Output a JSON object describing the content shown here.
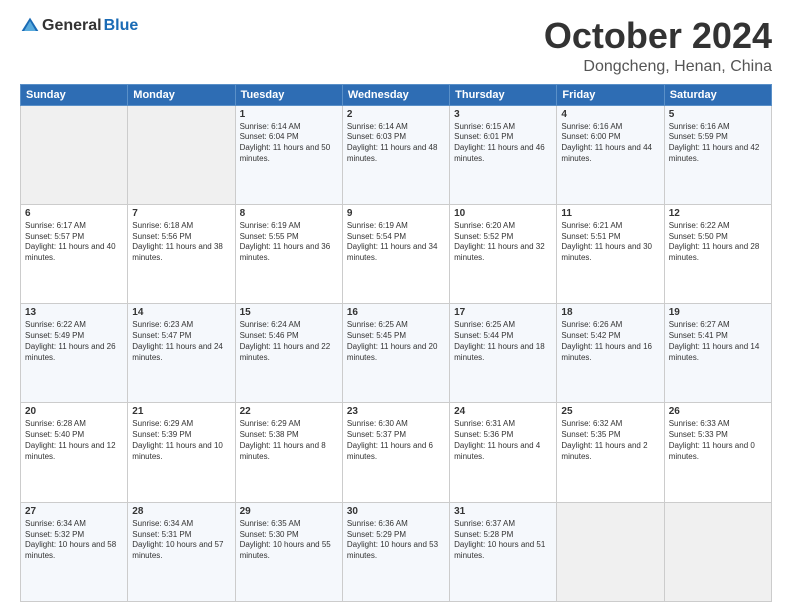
{
  "logo": {
    "general": "General",
    "blue": "Blue"
  },
  "header": {
    "month": "October 2024",
    "location": "Dongcheng, Henan, China"
  },
  "days_of_week": [
    "Sunday",
    "Monday",
    "Tuesday",
    "Wednesday",
    "Thursday",
    "Friday",
    "Saturday"
  ],
  "weeks": [
    [
      {
        "day": "",
        "sunrise": "",
        "sunset": "",
        "daylight": ""
      },
      {
        "day": "",
        "sunrise": "",
        "sunset": "",
        "daylight": ""
      },
      {
        "day": "1",
        "sunrise": "Sunrise: 6:14 AM",
        "sunset": "Sunset: 6:04 PM",
        "daylight": "Daylight: 11 hours and 50 minutes."
      },
      {
        "day": "2",
        "sunrise": "Sunrise: 6:14 AM",
        "sunset": "Sunset: 6:03 PM",
        "daylight": "Daylight: 11 hours and 48 minutes."
      },
      {
        "day": "3",
        "sunrise": "Sunrise: 6:15 AM",
        "sunset": "Sunset: 6:01 PM",
        "daylight": "Daylight: 11 hours and 46 minutes."
      },
      {
        "day": "4",
        "sunrise": "Sunrise: 6:16 AM",
        "sunset": "Sunset: 6:00 PM",
        "daylight": "Daylight: 11 hours and 44 minutes."
      },
      {
        "day": "5",
        "sunrise": "Sunrise: 6:16 AM",
        "sunset": "Sunset: 5:59 PM",
        "daylight": "Daylight: 11 hours and 42 minutes."
      }
    ],
    [
      {
        "day": "6",
        "sunrise": "Sunrise: 6:17 AM",
        "sunset": "Sunset: 5:57 PM",
        "daylight": "Daylight: 11 hours and 40 minutes."
      },
      {
        "day": "7",
        "sunrise": "Sunrise: 6:18 AM",
        "sunset": "Sunset: 5:56 PM",
        "daylight": "Daylight: 11 hours and 38 minutes."
      },
      {
        "day": "8",
        "sunrise": "Sunrise: 6:19 AM",
        "sunset": "Sunset: 5:55 PM",
        "daylight": "Daylight: 11 hours and 36 minutes."
      },
      {
        "day": "9",
        "sunrise": "Sunrise: 6:19 AM",
        "sunset": "Sunset: 5:54 PM",
        "daylight": "Daylight: 11 hours and 34 minutes."
      },
      {
        "day": "10",
        "sunrise": "Sunrise: 6:20 AM",
        "sunset": "Sunset: 5:52 PM",
        "daylight": "Daylight: 11 hours and 32 minutes."
      },
      {
        "day": "11",
        "sunrise": "Sunrise: 6:21 AM",
        "sunset": "Sunset: 5:51 PM",
        "daylight": "Daylight: 11 hours and 30 minutes."
      },
      {
        "day": "12",
        "sunrise": "Sunrise: 6:22 AM",
        "sunset": "Sunset: 5:50 PM",
        "daylight": "Daylight: 11 hours and 28 minutes."
      }
    ],
    [
      {
        "day": "13",
        "sunrise": "Sunrise: 6:22 AM",
        "sunset": "Sunset: 5:49 PM",
        "daylight": "Daylight: 11 hours and 26 minutes."
      },
      {
        "day": "14",
        "sunrise": "Sunrise: 6:23 AM",
        "sunset": "Sunset: 5:47 PM",
        "daylight": "Daylight: 11 hours and 24 minutes."
      },
      {
        "day": "15",
        "sunrise": "Sunrise: 6:24 AM",
        "sunset": "Sunset: 5:46 PM",
        "daylight": "Daylight: 11 hours and 22 minutes."
      },
      {
        "day": "16",
        "sunrise": "Sunrise: 6:25 AM",
        "sunset": "Sunset: 5:45 PM",
        "daylight": "Daylight: 11 hours and 20 minutes."
      },
      {
        "day": "17",
        "sunrise": "Sunrise: 6:25 AM",
        "sunset": "Sunset: 5:44 PM",
        "daylight": "Daylight: 11 hours and 18 minutes."
      },
      {
        "day": "18",
        "sunrise": "Sunrise: 6:26 AM",
        "sunset": "Sunset: 5:42 PM",
        "daylight": "Daylight: 11 hours and 16 minutes."
      },
      {
        "day": "19",
        "sunrise": "Sunrise: 6:27 AM",
        "sunset": "Sunset: 5:41 PM",
        "daylight": "Daylight: 11 hours and 14 minutes."
      }
    ],
    [
      {
        "day": "20",
        "sunrise": "Sunrise: 6:28 AM",
        "sunset": "Sunset: 5:40 PM",
        "daylight": "Daylight: 11 hours and 12 minutes."
      },
      {
        "day": "21",
        "sunrise": "Sunrise: 6:29 AM",
        "sunset": "Sunset: 5:39 PM",
        "daylight": "Daylight: 11 hours and 10 minutes."
      },
      {
        "day": "22",
        "sunrise": "Sunrise: 6:29 AM",
        "sunset": "Sunset: 5:38 PM",
        "daylight": "Daylight: 11 hours and 8 minutes."
      },
      {
        "day": "23",
        "sunrise": "Sunrise: 6:30 AM",
        "sunset": "Sunset: 5:37 PM",
        "daylight": "Daylight: 11 hours and 6 minutes."
      },
      {
        "day": "24",
        "sunrise": "Sunrise: 6:31 AM",
        "sunset": "Sunset: 5:36 PM",
        "daylight": "Daylight: 11 hours and 4 minutes."
      },
      {
        "day": "25",
        "sunrise": "Sunrise: 6:32 AM",
        "sunset": "Sunset: 5:35 PM",
        "daylight": "Daylight: 11 hours and 2 minutes."
      },
      {
        "day": "26",
        "sunrise": "Sunrise: 6:33 AM",
        "sunset": "Sunset: 5:33 PM",
        "daylight": "Daylight: 11 hours and 0 minutes."
      }
    ],
    [
      {
        "day": "27",
        "sunrise": "Sunrise: 6:34 AM",
        "sunset": "Sunset: 5:32 PM",
        "daylight": "Daylight: 10 hours and 58 minutes."
      },
      {
        "day": "28",
        "sunrise": "Sunrise: 6:34 AM",
        "sunset": "Sunset: 5:31 PM",
        "daylight": "Daylight: 10 hours and 57 minutes."
      },
      {
        "day": "29",
        "sunrise": "Sunrise: 6:35 AM",
        "sunset": "Sunset: 5:30 PM",
        "daylight": "Daylight: 10 hours and 55 minutes."
      },
      {
        "day": "30",
        "sunrise": "Sunrise: 6:36 AM",
        "sunset": "Sunset: 5:29 PM",
        "daylight": "Daylight: 10 hours and 53 minutes."
      },
      {
        "day": "31",
        "sunrise": "Sunrise: 6:37 AM",
        "sunset": "Sunset: 5:28 PM",
        "daylight": "Daylight: 10 hours and 51 minutes."
      },
      {
        "day": "",
        "sunrise": "",
        "sunset": "",
        "daylight": ""
      },
      {
        "day": "",
        "sunrise": "",
        "sunset": "",
        "daylight": ""
      }
    ]
  ]
}
